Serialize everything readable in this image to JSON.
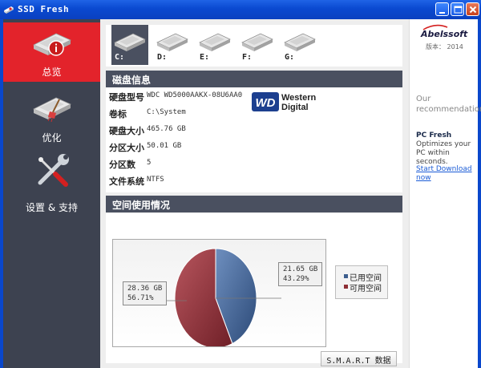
{
  "window": {
    "title": "SSD Fresh",
    "controls": [
      "minimize-icon",
      "maximize-icon",
      "close-icon"
    ]
  },
  "sidebar": {
    "items": [
      {
        "label": "总览",
        "icon": "hdd-info-icon",
        "active": true
      },
      {
        "label": "优化",
        "icon": "hdd-sweep-icon",
        "active": false
      },
      {
        "label": "设置 & 支持",
        "icon": "wrench-screwdriver-icon",
        "active": false
      }
    ]
  },
  "drives": [
    {
      "label": "C:",
      "selected": true
    },
    {
      "label": "D:",
      "selected": false
    },
    {
      "label": "E:",
      "selected": false
    },
    {
      "label": "F:",
      "selected": false
    },
    {
      "label": "G:",
      "selected": false
    }
  ],
  "disk_info": {
    "header": "磁盘信息",
    "rows": [
      {
        "label": "硬盘型号",
        "value": "WDC WD5000AAKX-08U6AA0"
      },
      {
        "label": "卷标",
        "value": "C:\\System"
      },
      {
        "label": "硬盘大小",
        "value": "465.76 GB"
      },
      {
        "label": "分区大小",
        "value": "50.01 GB"
      },
      {
        "label": "分区数",
        "value": "5"
      },
      {
        "label": "文件系统",
        "value": "NTFS"
      }
    ],
    "vendor_logo": {
      "mark": "WD",
      "line1": "Western",
      "line2": "Digital"
    }
  },
  "usage": {
    "header": "空间使用情况",
    "used_label": {
      "line1": "21.65 GB",
      "line2": "43.29%"
    },
    "free_label": {
      "line1": "28.36 GB",
      "line2": "56.71%"
    },
    "legend": [
      {
        "label": "已用空间",
        "color": "#3d5e8e"
      },
      {
        "label": "可用空间",
        "color": "#8e2f36"
      }
    ],
    "smart_button": "S.M.A.R.T 数据"
  },
  "chart_data": {
    "type": "pie",
    "categories": [
      "已用空间",
      "可用空间"
    ],
    "values": [
      21.65,
      28.36
    ],
    "percents": [
      43.29,
      56.71
    ],
    "colors": [
      "#3d5e8e",
      "#8e2f36"
    ]
  },
  "ad": {
    "brand": "Abelssoft",
    "version": "版本： 2014",
    "recommendation": "Our recommendation:",
    "product": "PC Fresh",
    "description": "Optimizes your PC within seconds.",
    "link": "Start Download now"
  },
  "colors": {
    "sidebar_bg": "#3d4250",
    "active_nav": "#e3232b",
    "section_header": "#4a5060",
    "titlebar": "#0a49d0"
  }
}
